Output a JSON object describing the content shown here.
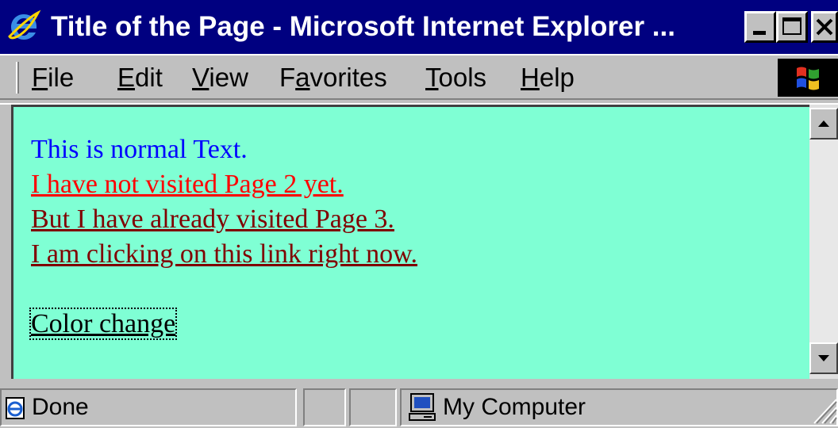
{
  "window": {
    "title": "Title of the Page - Microsoft Internet Explorer ...",
    "app_icon": "internet-explorer-icon",
    "controls": [
      "minimize-icon",
      "maximize-icon",
      "close-icon"
    ]
  },
  "menubar": {
    "items": [
      {
        "accel": "F",
        "rest": "ile"
      },
      {
        "accel": "E",
        "rest": "dit"
      },
      {
        "accel": "V",
        "rest": "iew"
      },
      {
        "pre": "F",
        "accel": "a",
        "rest": "vorites"
      },
      {
        "accel": "T",
        "rest": "ools"
      },
      {
        "accel": "H",
        "rest": "elp"
      }
    ],
    "logo": "windows-logo-icon"
  },
  "content": {
    "background": "#7fffd4",
    "normal_text": "This is normal Text.",
    "link_unvisited": "I have not visited Page 2 yet.",
    "link_visited": "But I have already visited Page 3.",
    "link_active": "I am clicking on this link right now.",
    "link_color_change": "Color change",
    "colors": {
      "text": "#0000ff",
      "link": "#ff0000",
      "vlink": "#800000",
      "alink": "#800000"
    }
  },
  "scrollbar": {
    "icons": [
      "scroll-up-arrow-icon",
      "scroll-down-arrow-icon"
    ]
  },
  "statusbar": {
    "status_text": "Done",
    "status_icon": "ie-page-icon",
    "zone_text": "My Computer",
    "zone_icon": "computer-icon"
  }
}
